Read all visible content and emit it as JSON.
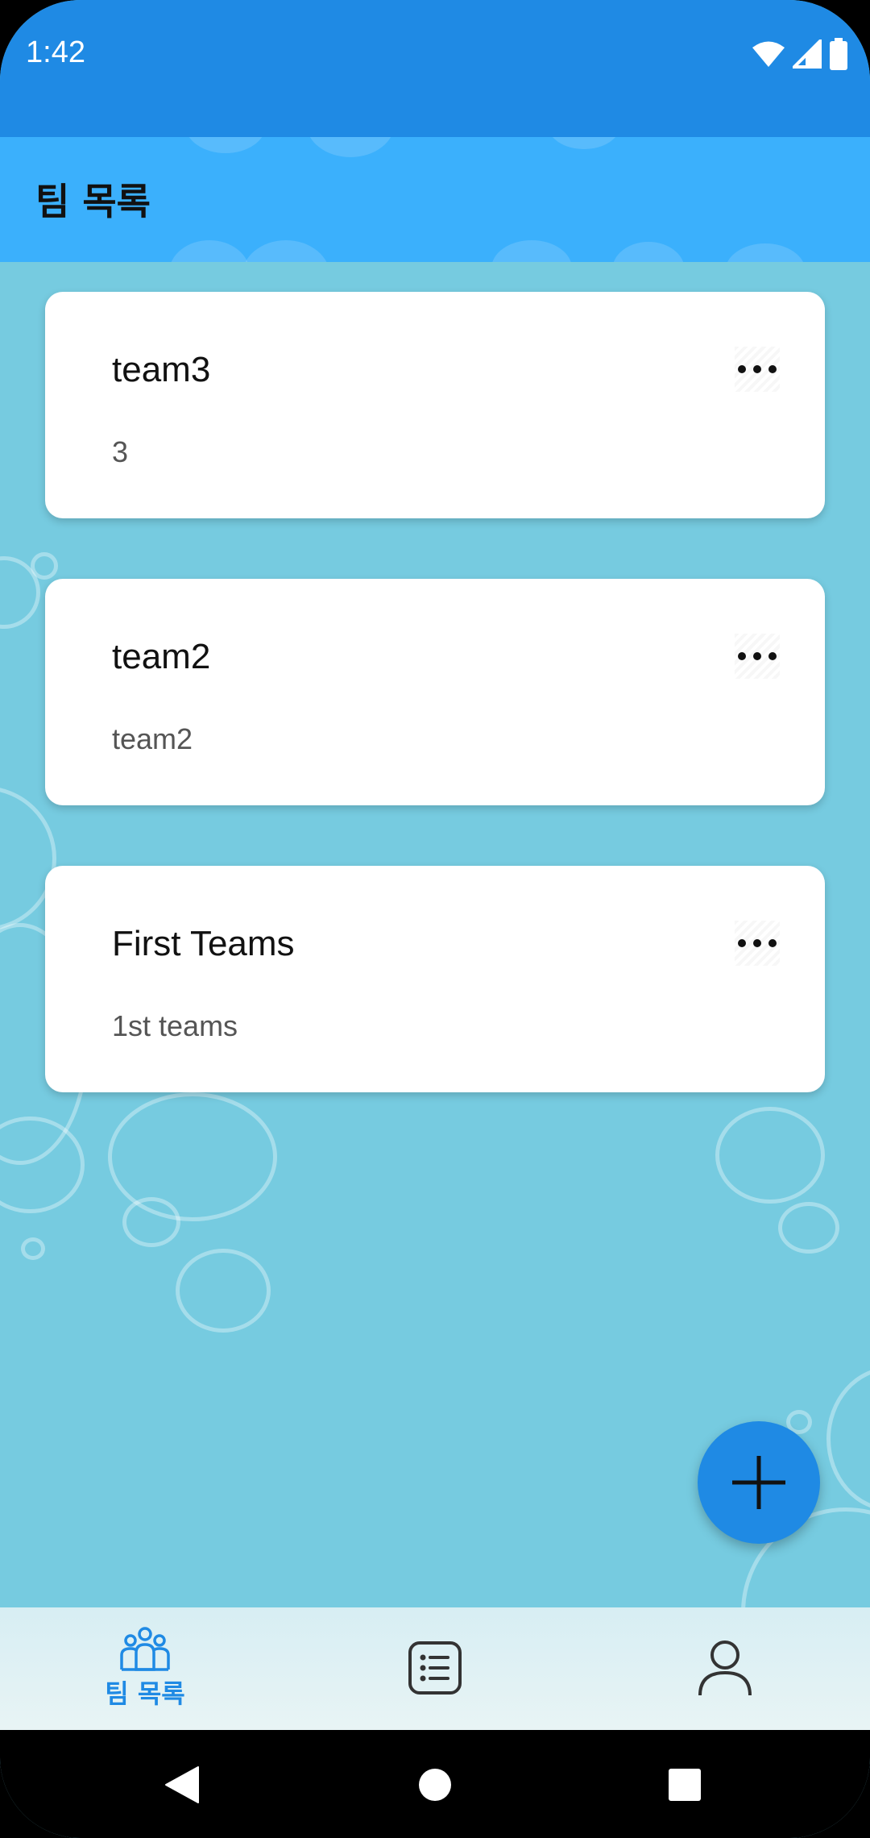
{
  "status_bar": {
    "time": "1:42"
  },
  "app_bar": {
    "title": "팀 목록"
  },
  "teams": [
    {
      "name": "team3",
      "description": "3"
    },
    {
      "name": "team2",
      "description": "team2"
    },
    {
      "name": "First Teams",
      "description": "1st teams"
    }
  ],
  "fab": {
    "icon": "plus-icon"
  },
  "bottom_nav": {
    "items": [
      {
        "icon": "group-icon",
        "label": "팀 목록",
        "selected": true
      },
      {
        "icon": "list-icon",
        "label": "",
        "selected": false
      },
      {
        "icon": "person-icon",
        "label": "",
        "selected": false
      }
    ]
  },
  "colors": {
    "primary": "#1f8ae4",
    "app_bar": "#3bb0fc",
    "background": "#76cbe0"
  }
}
